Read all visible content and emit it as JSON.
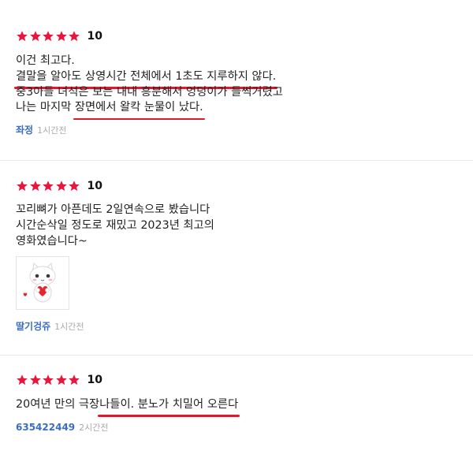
{
  "reviews": [
    {
      "score": "10",
      "lines": [
        [
          {
            "t": "이건 최고다.",
            "u": false
          }
        ],
        [
          {
            "t": "결말을 알아도 상영시간 전체에서 1초도 지루하지 않다.",
            "u": true
          }
        ],
        [
          {
            "t": "중3아들 녀석은 보는 내내  흥분해서 엉덩이가 들썩거렸고",
            "u": false
          }
        ],
        [
          {
            "t": "나는 마지막 ",
            "u": false
          },
          {
            "t": "장면에서 왈칵 눈물이 났다.",
            "u": true
          }
        ]
      ],
      "user": "좌정",
      "time": "1시간전"
    },
    {
      "score": "10",
      "lines": [
        [
          {
            "t": "꼬리뼈가 아픈데도 2일연속으로 봤습니다",
            "u": false
          }
        ],
        [
          {
            "t": "시간순삭일 정도로 재밌고 2023년  최고의",
            "u": false
          }
        ],
        [
          {
            "t": "영화였습니다~",
            "u": false
          }
        ]
      ],
      "sticker_icon": "cat-heart-sticker-icon",
      "user": "딸기겅쥬",
      "time": "1시간전"
    },
    {
      "score": "10",
      "lines": [
        [
          {
            "t": "20여년 만의 극장",
            "u": false
          },
          {
            "t": "나들이. 분노가 치밀어 오른다",
            "u": true
          }
        ]
      ],
      "user": "635422449",
      "time": "2시간전"
    }
  ],
  "colors": {
    "star": "#e8163c",
    "username": "#3b6ec2",
    "underline": "#e0182d",
    "time": "#aaaaaa"
  }
}
